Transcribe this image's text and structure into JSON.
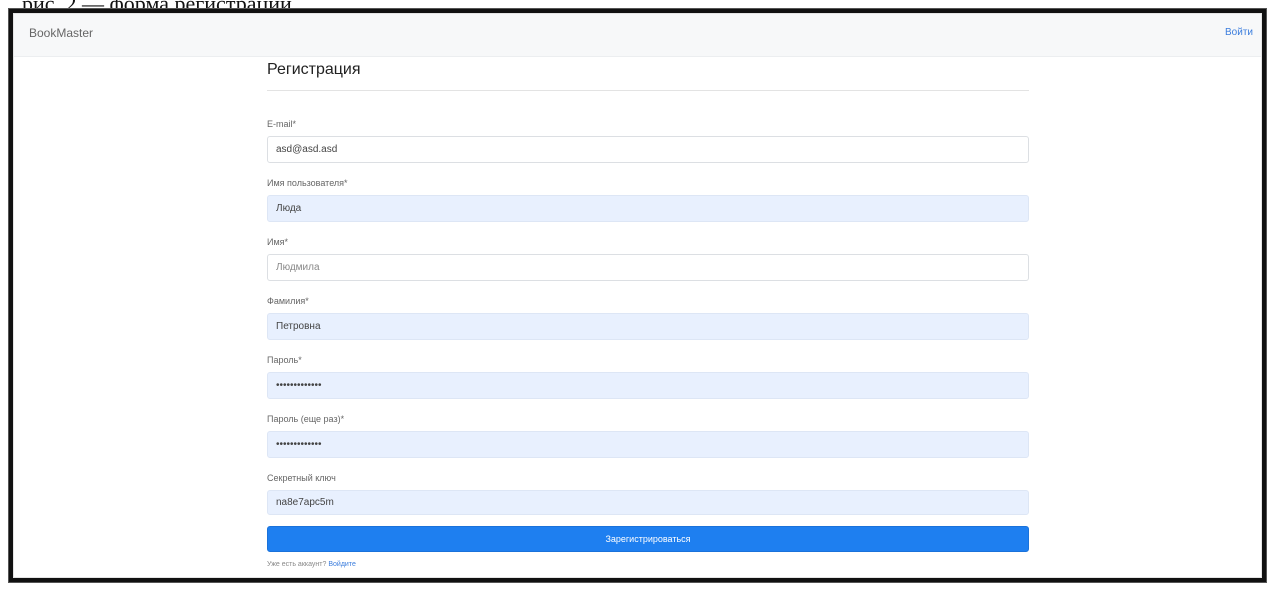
{
  "caption_fragment": "рис. 2 — форма регистрации",
  "navbar": {
    "brand": "BookMaster",
    "login_link": "Войти"
  },
  "form": {
    "title": "Регистрация",
    "fields": [
      {
        "label": "E-mail*",
        "value": "asd@asd.asd",
        "autofilled": false
      },
      {
        "label": "Имя пользователя*",
        "value": "Люда",
        "autofilled": true
      },
      {
        "label": "Имя*",
        "placeholder": "Людмила",
        "value": "",
        "autofilled": false
      },
      {
        "label": "Фамилия*",
        "value": "Петровна",
        "autofilled": true
      },
      {
        "label": "Пароль*",
        "value": "•••••••••••••",
        "autofilled": true
      },
      {
        "label": "Пароль (еще раз)*",
        "value": "•••••••••••••",
        "autofilled": true
      },
      {
        "label": "Секретный ключ",
        "value": "na8e7apc5m",
        "autofilled": true
      }
    ],
    "submit_label": "Зарегистрироваться",
    "footer_text": "Уже есть аккаунт?",
    "footer_link": "Войдите"
  },
  "colors": {
    "primary": "#1e7ff0",
    "link": "#3b7ddd",
    "autofill_bg": "#e8f0fe"
  }
}
